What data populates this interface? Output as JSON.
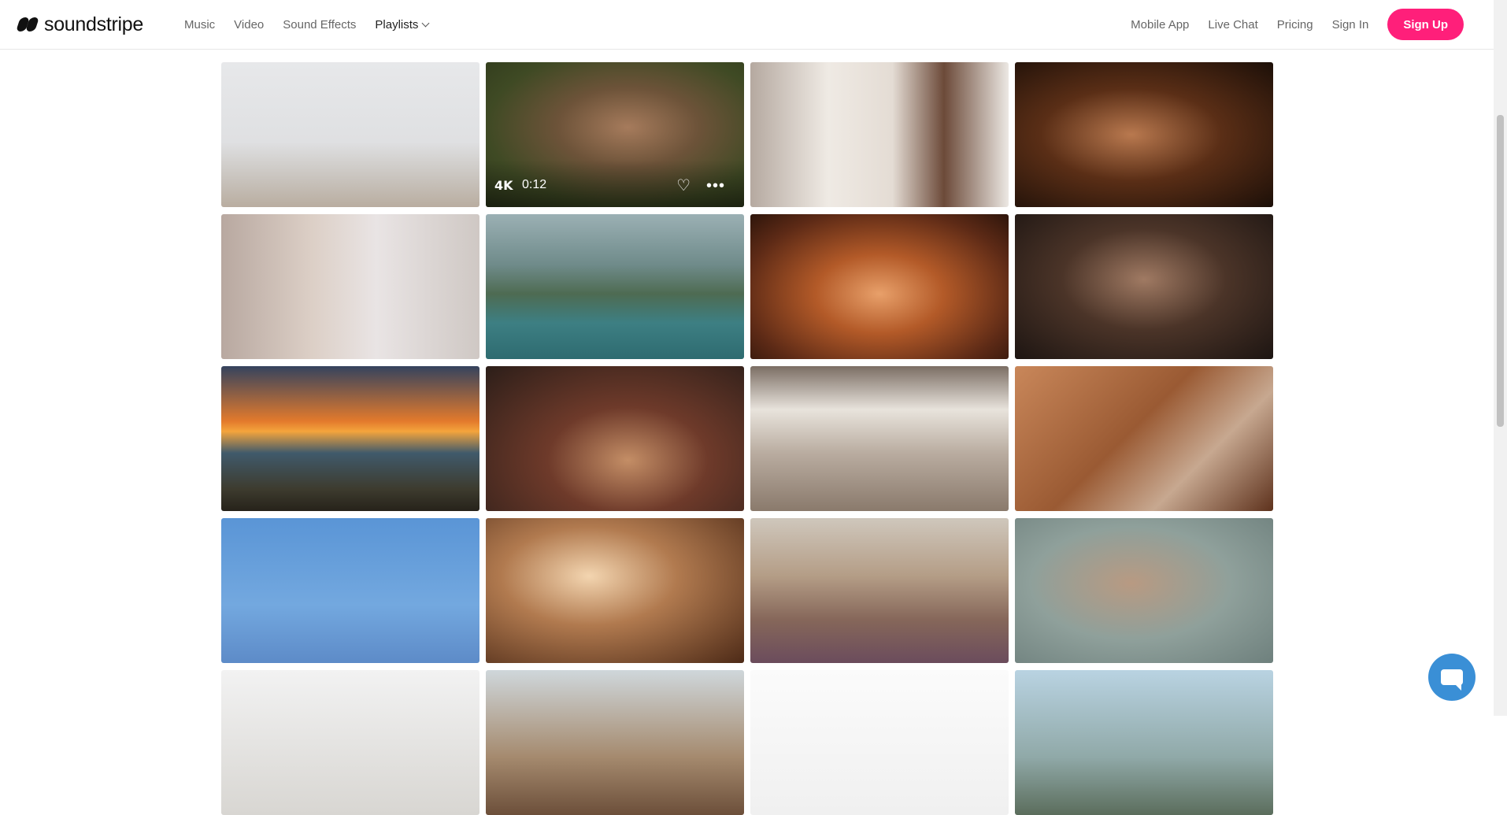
{
  "brand": {
    "name": "soundstripe",
    "accent": "#ff1f7a"
  },
  "nav": {
    "left": [
      "Music",
      "Video",
      "Sound Effects",
      "Playlists"
    ],
    "right": [
      "Mobile App",
      "Live Chat",
      "Pricing",
      "Sign In"
    ],
    "signup_label": "Sign Up"
  },
  "tiles": [
    {
      "bg": "linear-gradient(180deg,#e7e8ea 0%,#dfe0e2 55%,#c9c4be 80%,#b9ada0 100%)"
    },
    {
      "bg": "radial-gradient(ellipse at 55% 45%,#a67b5c 0%,#6d5339 35%,#3f4a24 70%,#2f3a1c 100%)",
      "hover": true,
      "badge": "4K",
      "duration": "0:12"
    },
    {
      "bg": "linear-gradient(90deg,#b5a9a0 0%,#efeae4 30%,#e4dcd4 55%,#6c4a39 75%,#ece8e3 100%)"
    },
    {
      "bg": "radial-gradient(ellipse at 45% 50%,#b9794f 0%,#5a2e16 45%,#1c0f08 100%)"
    },
    {
      "bg": "linear-gradient(90deg,#b8a8a0 0%,#dccfc6 35%,#e9e4e4 60%,#cfc8c4 100%)"
    },
    {
      "bg": "linear-gradient(180deg,#9bb0b4 0%,#6f8b8a 35%,#4e6b52 55%,#3d7f83 75%,#2e6b70 100%)"
    },
    {
      "bg": "radial-gradient(ellipse at 50% 55%,#e8a06a 0%,#b35a28 35%,#5d2a16 75%,#2e150b 100%)"
    },
    {
      "bg": "radial-gradient(ellipse at 50% 45%,#a07a63 0%,#4b3428 45%,#1d1512 100%)"
    },
    {
      "bg": "linear-gradient(180deg,#35435e 0%,#e37a2c 38%,#f4a43c 45%,#405a6b 60%,#3d3b2e 85%,#26221a 100%)"
    },
    {
      "bg": "radial-gradient(ellipse at 55% 65%,#c48e66 0%,#6e3a2a 40%,#2c1e19 100%)"
    },
    {
      "bg": "linear-gradient(180deg,#7b6e64 0%,#e8e3dc 30%,#b9aca0 60%,#8a7a6c 100%)"
    },
    {
      "bg": "linear-gradient(135deg,#c9875a 0%,#9a5a33 45%,#c7a890 70%,#5e321d 100%)"
    },
    {
      "bg": "linear-gradient(180deg,#5a95d6 0%,#73a8df 60%,#5d8bc8 100%)"
    },
    {
      "bg": "radial-gradient(ellipse at 40% 40%,#f3d5b0 0%,#b17a4f 40%,#4d2a17 100%)"
    },
    {
      "bg": "linear-gradient(180deg,#cfc7bc 0%,#b49d86 40%,#86675a 70%,#6b4c5c 100%)"
    },
    {
      "bg": "radial-gradient(ellipse at 45% 45%,#b89a82 0%,#8fa09b 50%,#6e807d 100%)"
    },
    {
      "bg": "linear-gradient(180deg,#f2f2f2 0%,#d8d6d2 100%)"
    },
    {
      "bg": "linear-gradient(180deg,#cfd7db 0%,#a58a6e 60%,#6c4f3a 100%)"
    },
    {
      "bg": "linear-gradient(180deg,#fbfbfb 0%,#f0f0f0 100%)"
    },
    {
      "bg": "linear-gradient(180deg,#b9d3e2 0%,#90a9a8 60%,#5b6d5c 100%)"
    }
  ],
  "icons": {
    "heart": "♡",
    "more": "•••"
  }
}
